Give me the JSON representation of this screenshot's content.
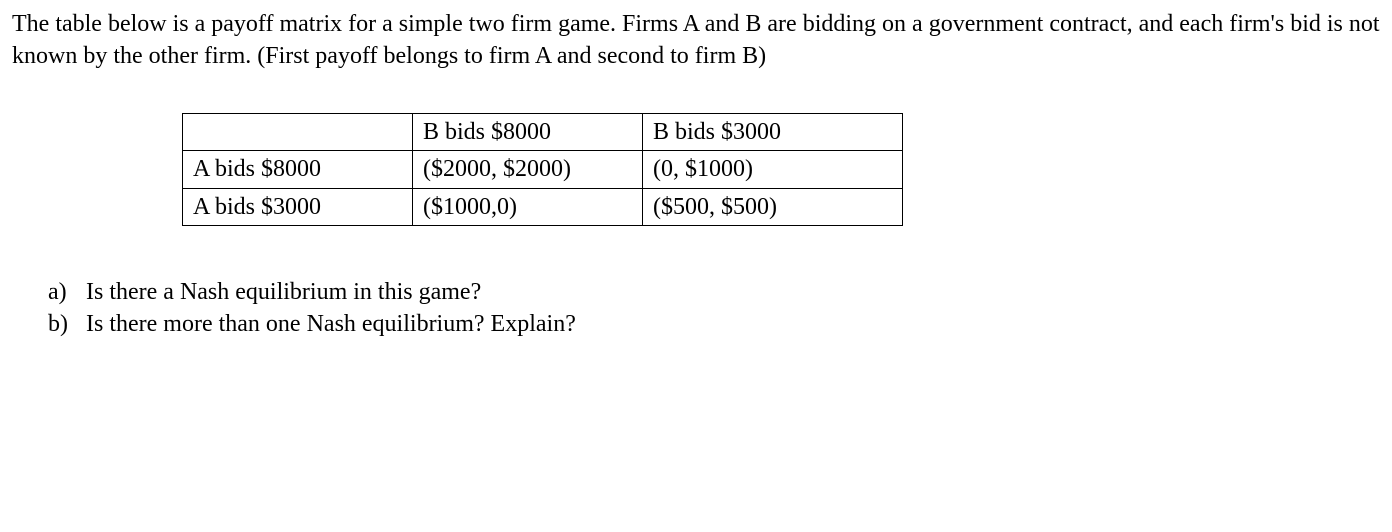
{
  "intro": "The table below is a payoff matrix for a simple two firm game. Firms A and B are bidding on a government contract, and each firm's bid is not known by the other firm. (First payoff belongs to firm A and second to firm B)",
  "table": {
    "header": [
      "",
      "B bids $8000",
      "B bids $3000"
    ],
    "rows": [
      {
        "label": "A bids $8000",
        "c1": "($2000, $2000)",
        "c2": "(0, $1000)"
      },
      {
        "label": "A bids $3000",
        "c1": "($1000,0)",
        "c2": "($500, $500)"
      }
    ]
  },
  "questions": [
    {
      "letter": "a)",
      "text": "Is there a Nash equilibrium in this game?"
    },
    {
      "letter": "b)",
      "text": "Is there more than one Nash equilibrium? Explain?"
    }
  ]
}
